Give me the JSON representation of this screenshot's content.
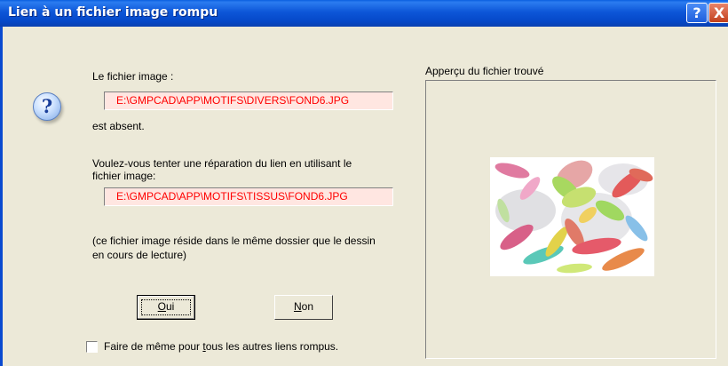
{
  "window": {
    "title": "Lien à un fichier image rompu",
    "help_label": "?",
    "close_label": "X"
  },
  "message": {
    "missing_label": "Le fichier image :",
    "missing_path": "E:\\GMPCAD\\APP\\MOTIFS\\DIVERS\\FOND6.JPG",
    "absent_text": "est absent.",
    "question_line1": "Voulez-vous tenter une réparation du lien en utilisant le",
    "question_line2": "fichier image:",
    "found_path": "E:\\GMPCAD\\APP\\MOTIFS\\TISSUS\\FOND6.JPG",
    "note_line1": "(ce fichier image réside dans le même dossier que le dessin",
    "note_line2": "en cours de lecture)"
  },
  "buttons": {
    "oui_first": "O",
    "oui_rest": "ui",
    "non_first": "N",
    "non_rest": "on"
  },
  "checkbox": {
    "label_before": "Faire de même pour ",
    "label_underlined": "t",
    "label_after": "ous les autres liens rompus.",
    "checked": false
  },
  "preview": {
    "label": "Apperçu du fichier trouvé"
  },
  "icons": {
    "question": "question-icon",
    "help": "help-icon",
    "close": "close-icon"
  }
}
